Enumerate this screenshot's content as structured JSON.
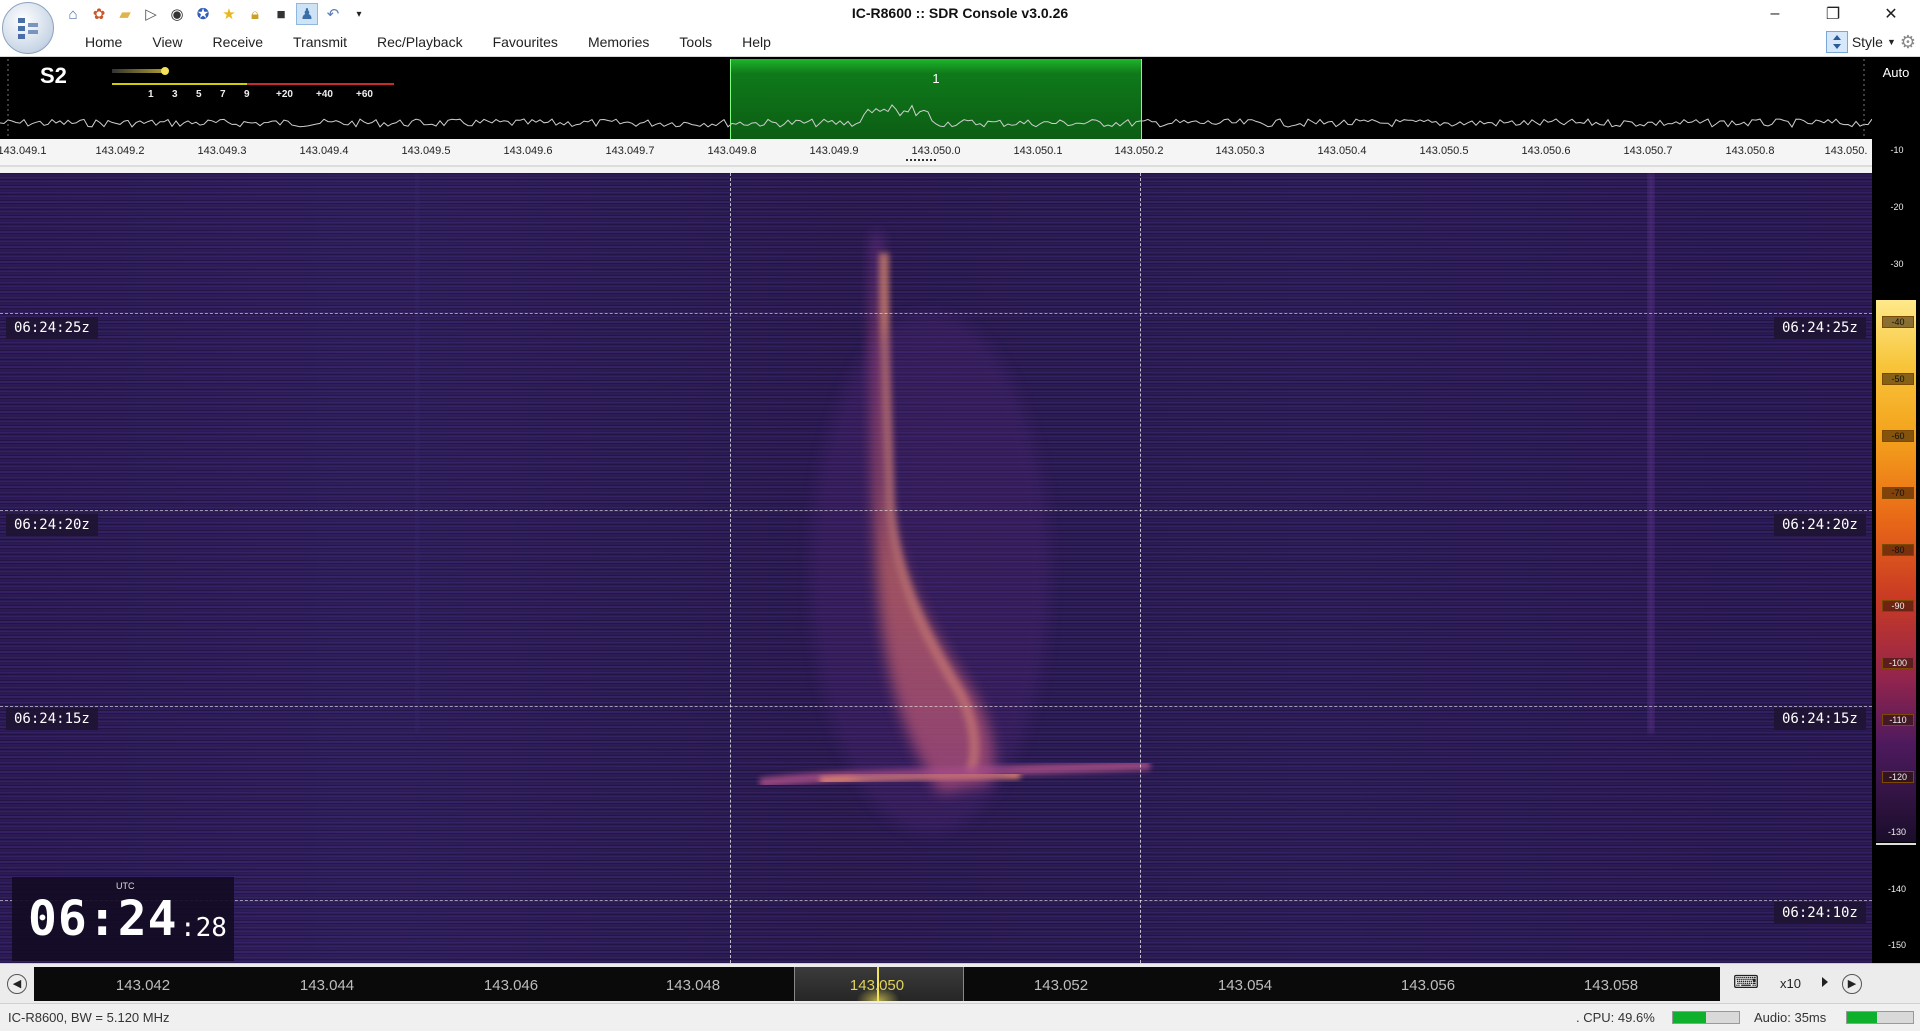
{
  "window": {
    "title": "IC-R8600 :: SDR Console v3.0.26",
    "controls": [
      "–",
      "❐",
      "✕"
    ]
  },
  "quick_access": [
    "home-icon",
    "settings-wheel-icon",
    "folder-icon",
    "play-icon",
    "stop-icon",
    "connect-icon",
    "star-icon",
    "lock-icon",
    "camera-icon",
    "user-icon",
    "undo-icon",
    "dropdown-icon"
  ],
  "menu": {
    "items": [
      "Home",
      "View",
      "Receive",
      "Transmit",
      "Rec/Playback",
      "Favourites",
      "Memories",
      "Tools",
      "Help"
    ],
    "style_label": "Style"
  },
  "spectrum": {
    "smeter_value": "S2",
    "smeter_scale": [
      "1",
      "3",
      "5",
      "7",
      "9",
      "+20",
      "+40",
      "+60"
    ],
    "vfo_number": "1",
    "auto_label": "Auto",
    "freq_labels": [
      "143.049.1",
      "143.049.2",
      "143.049.3",
      "143.049.4",
      "143.049.5",
      "143.049.6",
      "143.049.7",
      "143.049.8",
      "143.049.9",
      "143.050.0",
      "143.050.1",
      "143.050.2",
      "143.050.3",
      "143.050.4",
      "143.050.5",
      "143.050.6",
      "143.050.7",
      "143.050.8",
      "143.050."
    ]
  },
  "db_scale": [
    "-10",
    "-20",
    "-30",
    "-40",
    "-50",
    "-60",
    "-70",
    "-80",
    "-90",
    "-100",
    "-110",
    "-120",
    "-130",
    "-140",
    "-150"
  ],
  "waterfall": {
    "time_tags": [
      "06:24:25z",
      "06:24:20z",
      "06:24:15z",
      "06:24:10z"
    ],
    "clock": {
      "utc_label": "UTC",
      "hours_minutes": "06:24",
      "seconds": ":28"
    }
  },
  "bandscope": {
    "freq_labels": [
      "143.042",
      "143.044",
      "143.046",
      "143.048",
      "143.050",
      "143.052",
      "143.054",
      "143.056",
      "143.058"
    ],
    "active_label": "143.050",
    "zoom": "x10"
  },
  "status": {
    "device": "IC-R8600, BW = 5.120 MHz",
    "cpu": ". CPU: 49.6%",
    "cpu_level": 0.5,
    "audio": "Audio: 35ms",
    "audio_level": 0.45
  },
  "colors": {
    "vfo_green": "#0f7a1a",
    "waterfall_bg": "#2a1a52",
    "signal": "#e8795a",
    "meter_green": "#0fb02c"
  }
}
